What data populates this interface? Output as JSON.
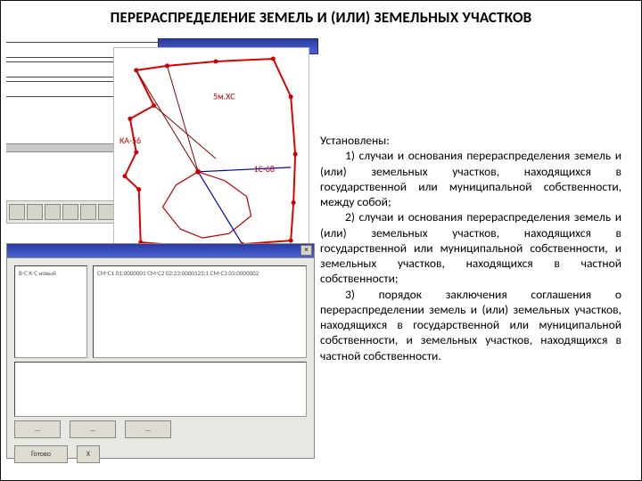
{
  "title": "ПЕРЕРАСПРЕДЕЛЕНИЕ  ЗЕМЕЛЬ И (ИЛИ) ЗЕМЕЛЬНЫХ УЧАСТКОВ",
  "map": {
    "label_a": "КА-56",
    "label_b": "5м.ΧС",
    "label_c": "1С-68"
  },
  "dialog": {
    "left_lines": "В-С\nК-С новый",
    "right_lines": "СМ-С1  01:0000001\nСМ-С2  02:23:0000123:1\nСМ-С3  03:0000002",
    "btn1": "…",
    "btn2": "…",
    "btn3": "…",
    "btn_ok": "Готово",
    "btn_x": "Х",
    "close": "×"
  },
  "text": {
    "lead": "Установлены:",
    "p1": "1) случаи и основания перераспределения земель и (или) земельных участков, находящихся в государственной или муниципальной собственности, между собой;",
    "p2": "2) случаи и основания перераспределения земель и (или) земельных участков, находящихся в государственной или муниципальной собственности, и земельных участков, находящихся в частной собственности;",
    "p3": "3) порядок заключения соглашения о перераспределении земель и (или) земельных участков, находящихся в государственной или муниципальной собственности, и земельных участков, находящихся в частной собственности."
  }
}
